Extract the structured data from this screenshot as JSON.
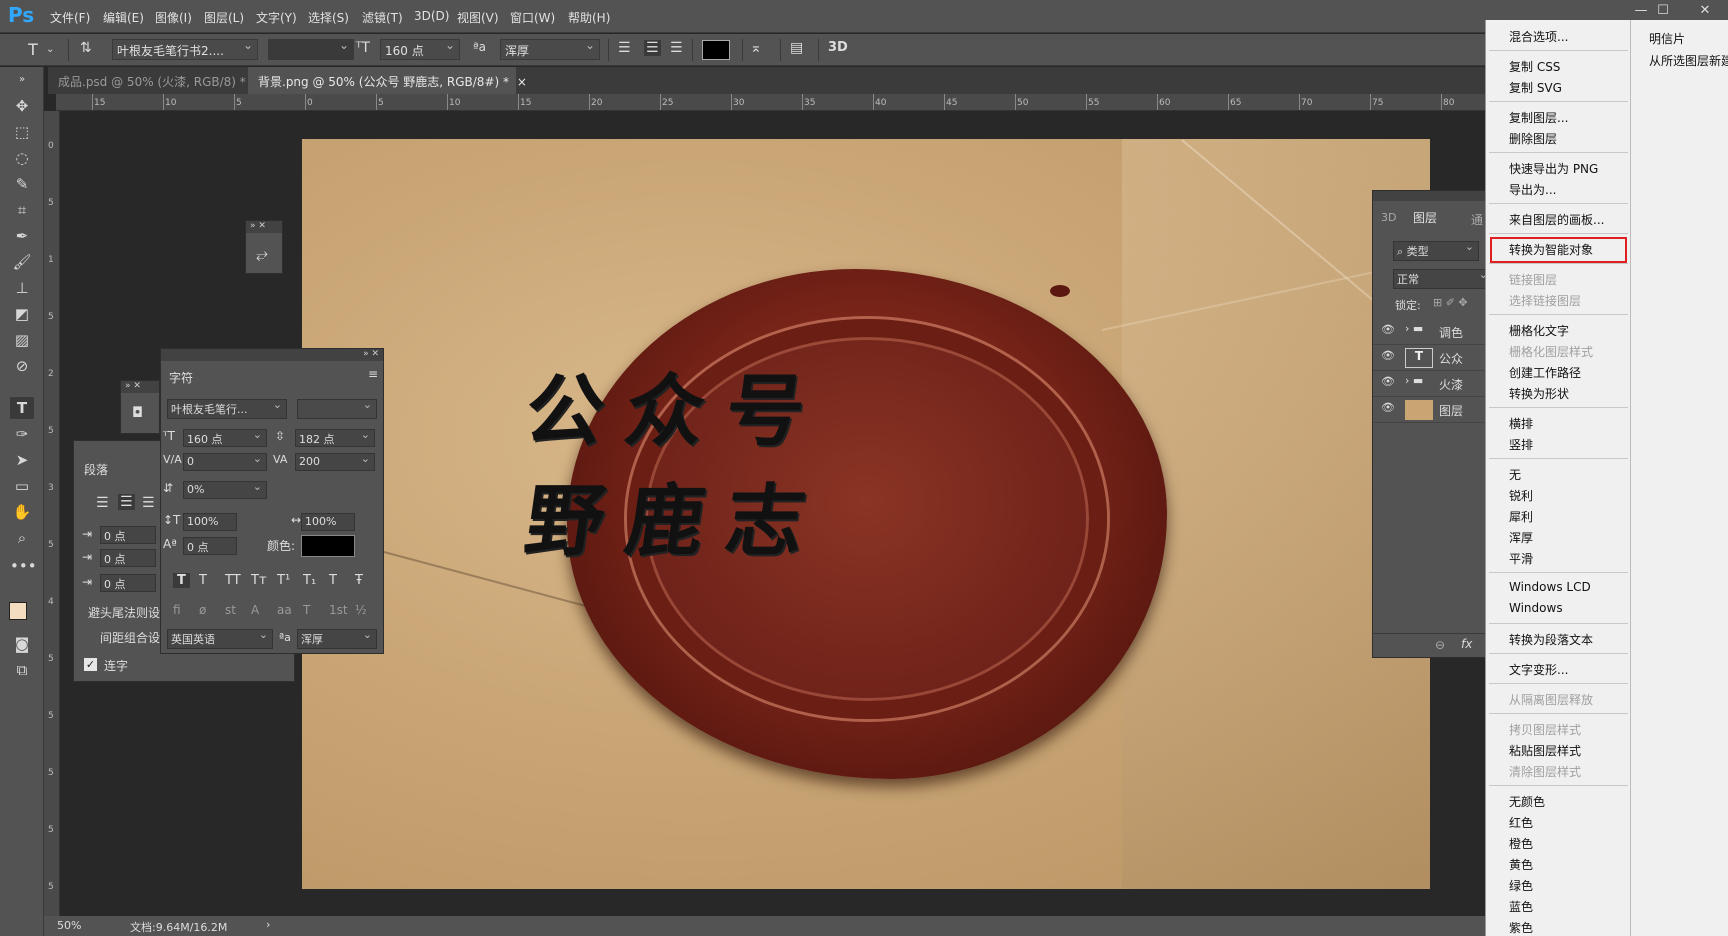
{
  "app": {
    "logo": "Ps",
    "menus": [
      "文件(F)",
      "编辑(E)",
      "图像(I)",
      "图层(L)",
      "文字(Y)",
      "选择(S)",
      "滤镜(T)",
      "3D(D)",
      "视图(V)",
      "窗口(W)",
      "帮助(H)"
    ],
    "window_controls": [
      "—",
      "☐",
      "✕"
    ]
  },
  "options_bar": {
    "font_family": "叶根友毛笔行书2....",
    "font_size": "160 点",
    "anti_alias": "浑厚",
    "three_d": "3D",
    "text_color": "#000000"
  },
  "tabs": [
    {
      "label": "成品.psd @ 50% (火漆, RGB/8) *",
      "close": "×"
    },
    {
      "label": "背景.png @ 50% (公众号 野鹿志, RGB/8#) *",
      "close": "×"
    }
  ],
  "ruler": {
    "h": [
      "15",
      "10",
      "5",
      "0",
      "5",
      "10",
      "15",
      "20",
      "25",
      "30",
      "35",
      "40",
      "45",
      "50",
      "55",
      "60",
      "65",
      "70",
      "75",
      "80"
    ],
    "v": [
      "0",
      "5",
      "1",
      "5",
      "2",
      "5",
      "3",
      "5",
      "4",
      "5",
      "5",
      "5",
      "5",
      "5"
    ]
  },
  "canvas_text": {
    "line1": "公众号",
    "line2": "野鹿志"
  },
  "status": {
    "zoom": "50%",
    "doc": "文档:9.64M/16.2M",
    "arrow": "›"
  },
  "character_panel": {
    "title": "字符",
    "font_family": "叶根友毛笔行...",
    "font_size": "160 点",
    "leading": "182 点",
    "kerning": "0",
    "tracking": "200",
    "scale_pct": "0%",
    "vscale": "100%",
    "hscale": "100%",
    "baseline": "0 点",
    "color_label": "颜色:",
    "color": "#000000",
    "style_buttons": [
      "T",
      "T",
      "TT",
      "Tт",
      "T¹",
      "T₁",
      "T",
      "Ŧ"
    ],
    "opentype_buttons": [
      "fi",
      "ø",
      "st",
      "A",
      "aa",
      "T",
      "1st",
      "½"
    ],
    "language": "英国英语",
    "antialias": "浑厚",
    "aa_icon": "ªa"
  },
  "paragraph_panel": {
    "title": "段落",
    "indent_left": "0 点",
    "indent_first": "0 点",
    "space_before": "0 点",
    "kinsoku": "避头尾法则设",
    "mojikumi": "间距组合设",
    "hyphenate_label": "连字"
  },
  "layers_panel": {
    "tabs": [
      "3D",
      "图层",
      "通"
    ],
    "filter": "类型",
    "blend": "正常",
    "lock_label": "锁定:",
    "layers": [
      {
        "name": "调色",
        "kind": "folder"
      },
      {
        "name": "公众",
        "kind": "text"
      },
      {
        "name": "火漆",
        "kind": "folder"
      },
      {
        "name": "图层",
        "kind": "image"
      }
    ],
    "footer": [
      "⊖",
      "fx"
    ]
  },
  "context_menu": {
    "groups": [
      [
        {
          "label": "混合选项...",
          "enabled": true
        }
      ],
      [
        {
          "label": "复制 CSS",
          "enabled": true
        },
        {
          "label": "复制 SVG",
          "enabled": true
        }
      ],
      [
        {
          "label": "复制图层...",
          "enabled": true
        },
        {
          "label": "删除图层",
          "enabled": true
        }
      ],
      [
        {
          "label": "快速导出为 PNG",
          "enabled": true
        },
        {
          "label": "导出为...",
          "enabled": true
        }
      ],
      [
        {
          "label": "来自图层的画板...",
          "enabled": true
        }
      ],
      [
        {
          "label": "转换为智能对象",
          "enabled": true,
          "highlighted": true
        }
      ],
      [
        {
          "label": "链接图层",
          "enabled": false
        },
        {
          "label": "选择链接图层",
          "enabled": false
        }
      ],
      [
        {
          "label": "栅格化文字",
          "enabled": true
        },
        {
          "label": "栅格化图层样式",
          "enabled": false
        },
        {
          "label": "创建工作路径",
          "enabled": true
        },
        {
          "label": "转换为形状",
          "enabled": true
        }
      ],
      [
        {
          "label": "横排",
          "enabled": true
        },
        {
          "label": "竖排",
          "enabled": true
        }
      ],
      [
        {
          "label": "无",
          "enabled": true
        },
        {
          "label": "锐利",
          "enabled": true
        },
        {
          "label": "犀利",
          "enabled": true
        },
        {
          "label": "浑厚",
          "enabled": true
        },
        {
          "label": "平滑",
          "enabled": true
        }
      ],
      [
        {
          "label": "Windows LCD",
          "enabled": true
        },
        {
          "label": "Windows",
          "enabled": true
        }
      ],
      [
        {
          "label": "转换为段落文本",
          "enabled": true
        }
      ],
      [
        {
          "label": "文字变形...",
          "enabled": true
        }
      ],
      [
        {
          "label": "从隔离图层释放",
          "enabled": false
        }
      ],
      [
        {
          "label": "拷贝图层样式",
          "enabled": false
        },
        {
          "label": "粘贴图层样式",
          "enabled": true
        },
        {
          "label": "清除图层样式",
          "enabled": false
        }
      ],
      [
        {
          "label": "无颜色",
          "enabled": true
        },
        {
          "label": "红色",
          "enabled": true
        },
        {
          "label": "橙色",
          "enabled": true
        },
        {
          "label": "黄色",
          "enabled": true
        },
        {
          "label": "绿色",
          "enabled": true
        },
        {
          "label": "蓝色",
          "enabled": true
        },
        {
          "label": "紫色",
          "enabled": true
        }
      ]
    ],
    "highlight_color": "#e02020"
  },
  "context_menu_right": {
    "items": [
      "明信片",
      "从所选图层新建"
    ]
  }
}
